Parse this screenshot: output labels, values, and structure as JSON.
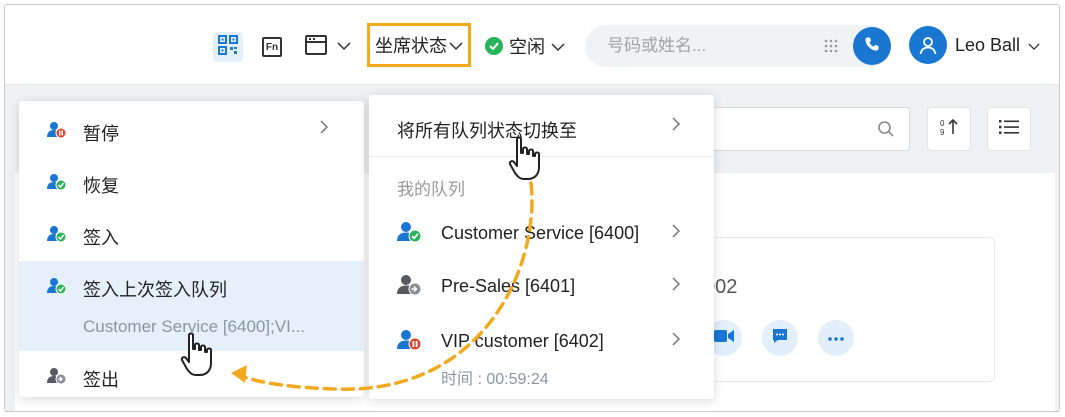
{
  "topbar": {
    "qr_icon": "qr-code-icon",
    "fn_label": "Fn",
    "window_icon": "window-icon",
    "seat_status_label": "坐席状态",
    "presence_label": "空闲",
    "search_placeholder": "号码或姓名...",
    "user_name": "Leo Ball"
  },
  "background": {
    "card_ext_suffix": "002"
  },
  "left_menu": {
    "items": [
      {
        "label": "暂停",
        "icon": "agent-pause-icon",
        "has_submenu": true
      },
      {
        "label": "恢复",
        "icon": "agent-resume-icon"
      },
      {
        "label": "签入",
        "icon": "agent-login-icon"
      },
      {
        "label": "签入上次签入队列",
        "icon": "agent-login-icon",
        "sub": "Customer Service [6400];VI..."
      },
      {
        "label": "签出",
        "icon": "agent-logout-icon"
      }
    ]
  },
  "right_menu": {
    "header": "将所有队列状态切换至",
    "section": "我的队列",
    "queues": [
      {
        "label": "Customer Service [6400]",
        "status": "online"
      },
      {
        "label": "Pre-Sales [6401]",
        "status": "logged-out"
      },
      {
        "label": "VIP customer [6402]",
        "status": "paused"
      }
    ],
    "pause_time": "时间 : 00:59:24"
  },
  "colors": {
    "accent": "#1977d2",
    "highlight_border": "#f3a91e",
    "arrow": "#f3a91e",
    "online": "#29b358",
    "paused": "#e0442c",
    "logged_out": "#8a8f96"
  }
}
